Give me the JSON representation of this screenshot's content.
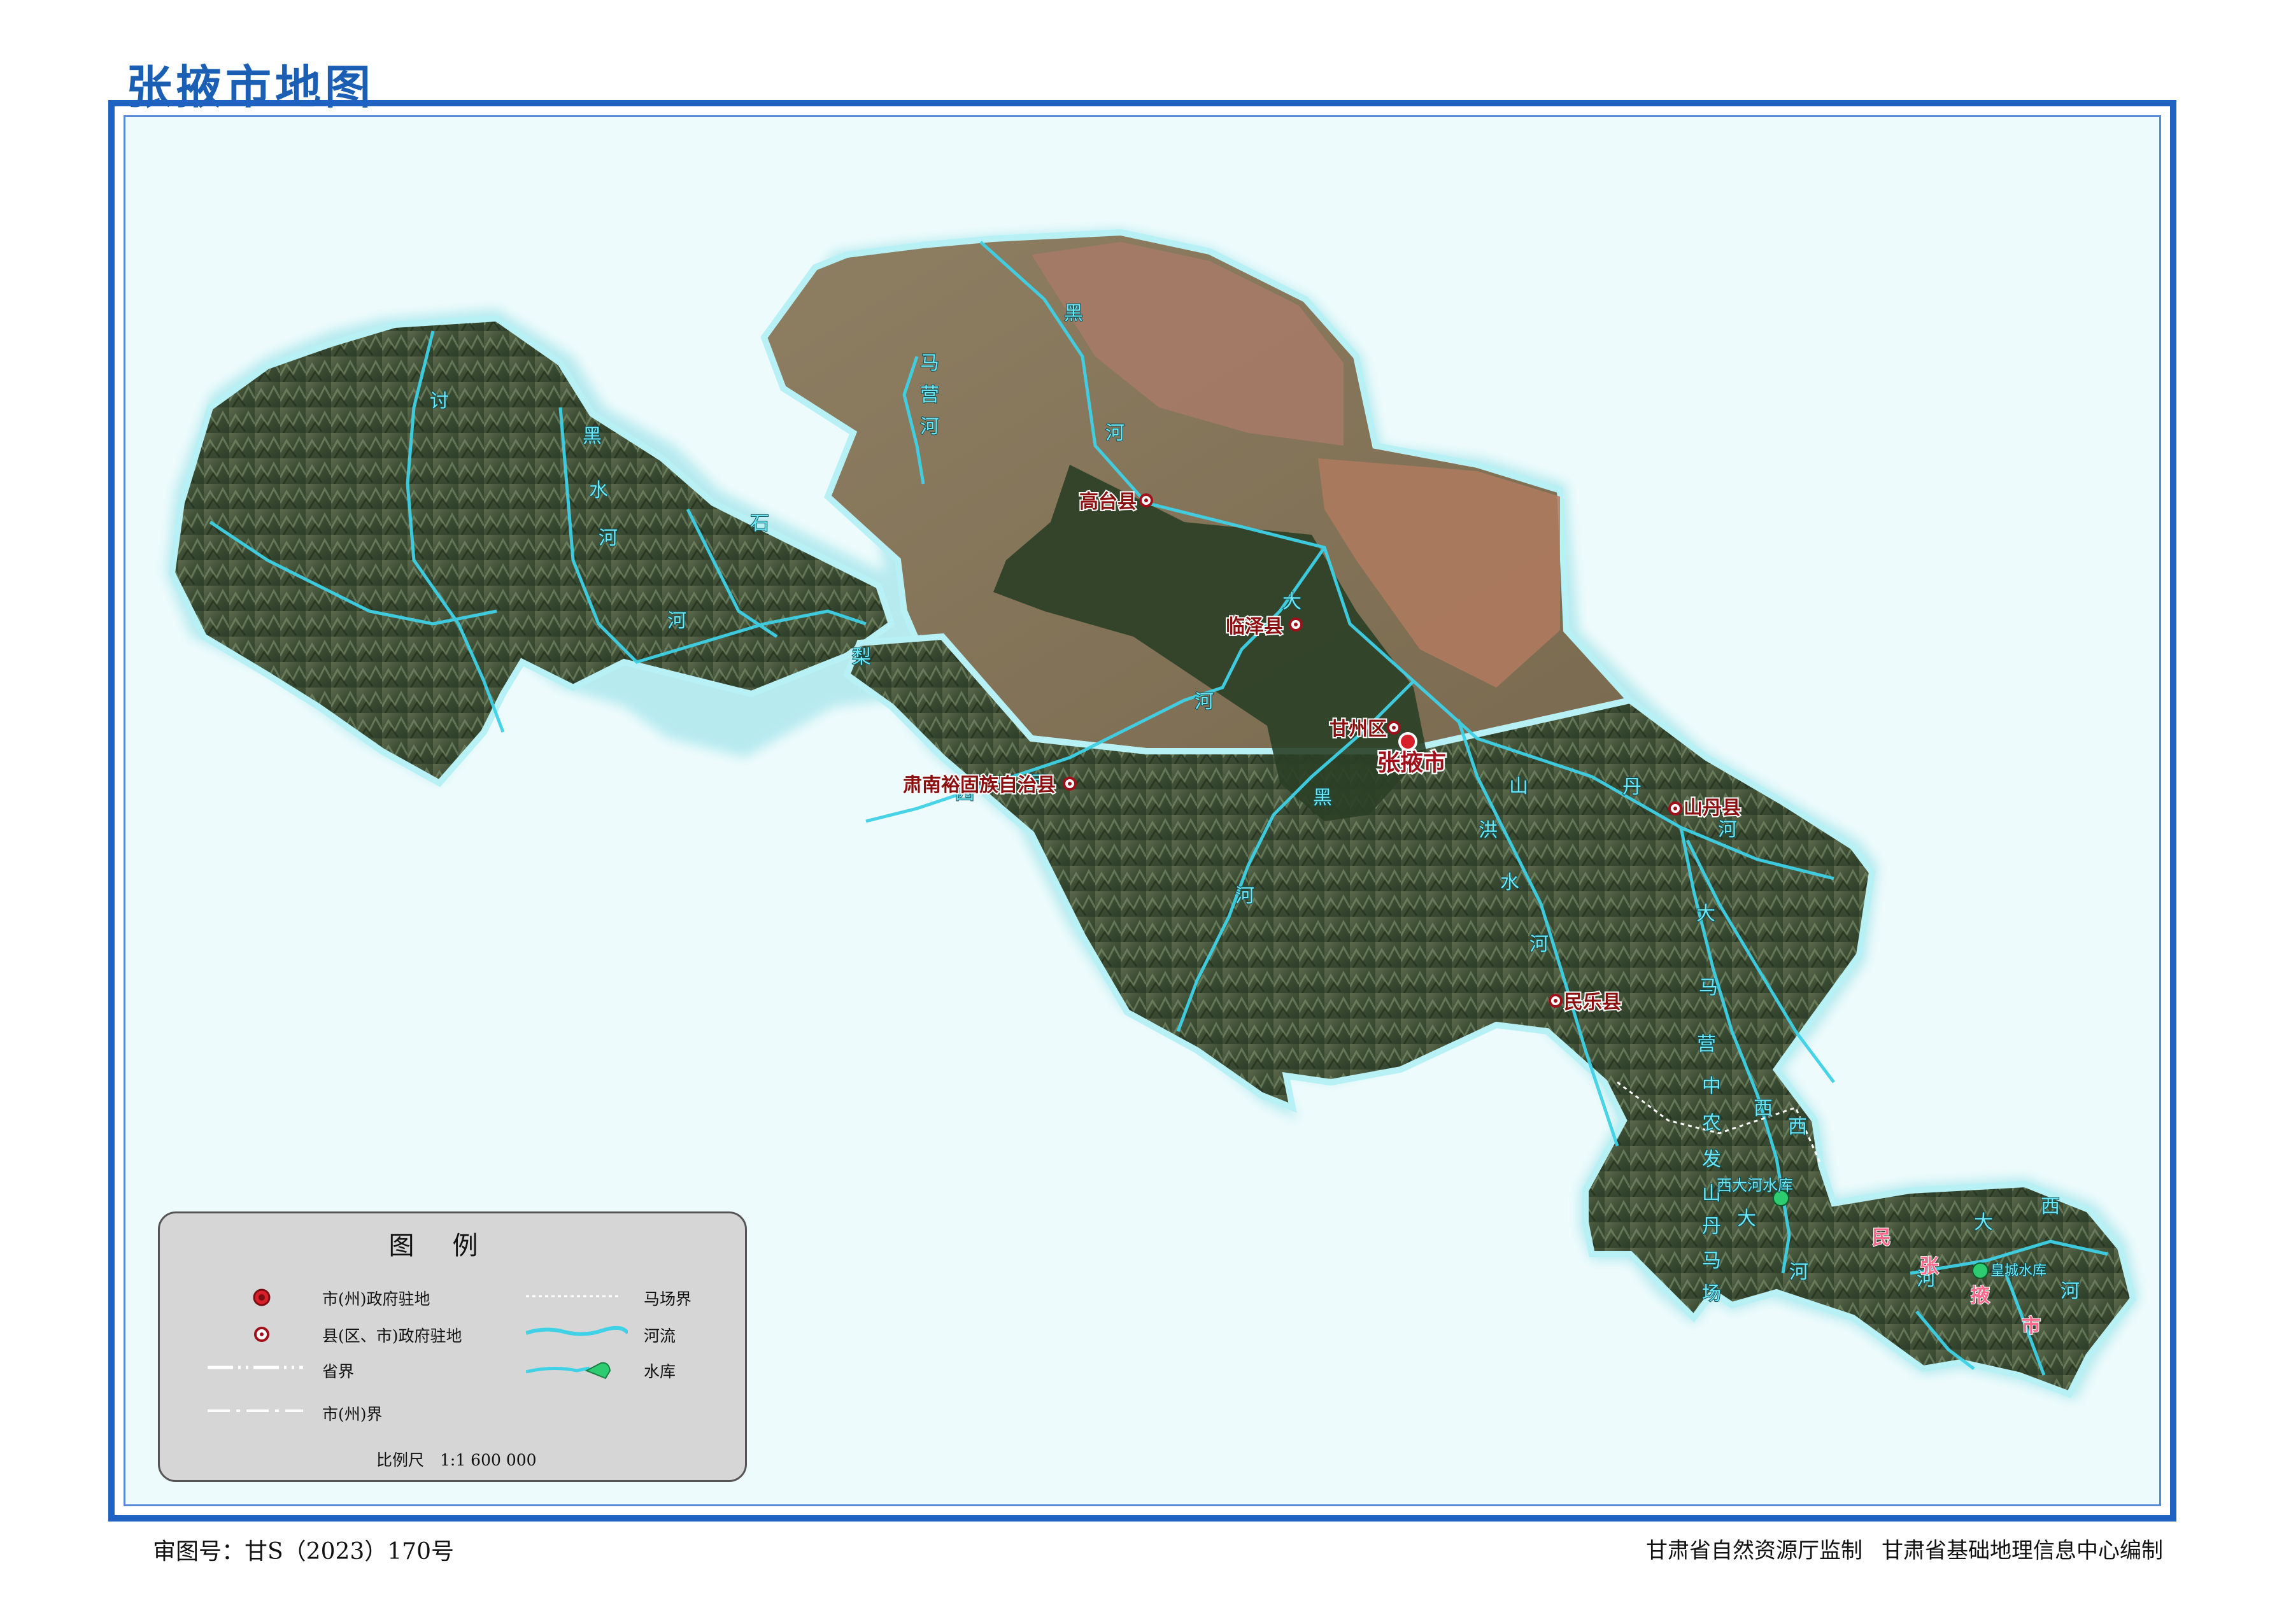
{
  "title": "张掖市地图",
  "footer": {
    "approval": "审图号：甘S（2023）170号",
    "supervisor": "甘肃省自然资源厅监制",
    "compiler": "甘肃省基础地理信息中心编制"
  },
  "legend": {
    "title": "图例",
    "items": {
      "city_seat": "市(州)政府驻地",
      "county_seat": "县(区、市)政府驻地",
      "province_boundary": "省界",
      "city_boundary": "市(州)界",
      "ranch_boundary": "马场界",
      "river": "河流",
      "reservoir": "水库"
    },
    "scale": "比例尺　1:1 600 000"
  },
  "places": {
    "gaotai": "高台县",
    "linze": "临泽县",
    "ganzhou": "甘州区",
    "zhangye": "张掖市",
    "shandan": "山丹县",
    "minle": "民乐县",
    "sunan": "肃南裕固族自治县",
    "xidahe": "西大河水库",
    "huangcheng": "皇城水库"
  },
  "colors": {
    "frame": "#1f62c2",
    "title": "#1a5fb4",
    "sea": "#eefbfc",
    "river": "#3fd1e6",
    "place": "#8b0f0f",
    "reservoir": "#2ecc71"
  }
}
